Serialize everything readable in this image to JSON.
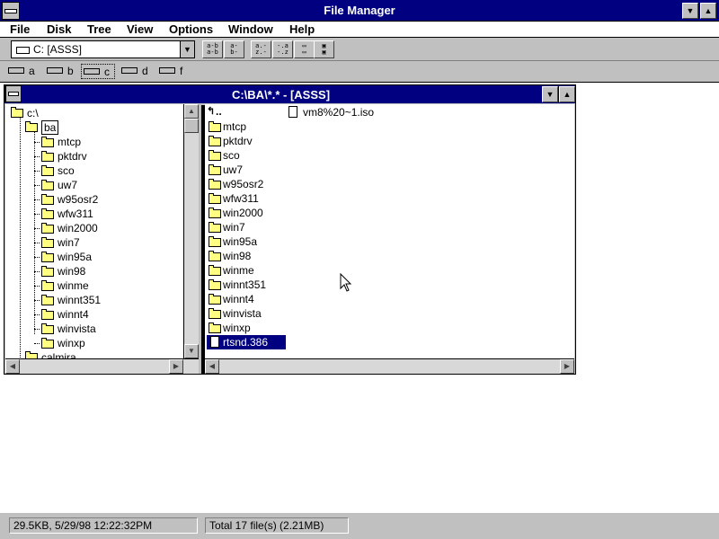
{
  "window": {
    "title": "File Manager"
  },
  "menu": [
    "File",
    "Disk",
    "Tree",
    "View",
    "Options",
    "Window",
    "Help"
  ],
  "toolbar": {
    "drive_combo": "C: [ASSS]"
  },
  "drives": [
    {
      "letter": "a",
      "selected": false
    },
    {
      "letter": "b",
      "selected": false
    },
    {
      "letter": "c",
      "selected": true
    },
    {
      "letter": "d",
      "selected": false
    },
    {
      "letter": "f",
      "selected": false
    }
  ],
  "child": {
    "title": "C:\\BA\\*.* - [ASSS]"
  },
  "tree": {
    "root": "c:\\",
    "current": "ba",
    "subfolders": [
      "mtcp",
      "pktdrv",
      "sco",
      "uw7",
      "w95osr2",
      "wfw311",
      "win2000",
      "win7",
      "win95a",
      "win98",
      "winme",
      "winnt351",
      "winnt4",
      "winvista",
      "winxp"
    ],
    "next_sibling": "calmira"
  },
  "files": {
    "up_dir": "..",
    "first_file": "vm8%20~1.iso",
    "folders": [
      "mtcp",
      "pktdrv",
      "sco",
      "uw7",
      "w95osr2",
      "wfw311",
      "win2000",
      "win7",
      "win95a",
      "win98",
      "winme",
      "winnt351",
      "winnt4",
      "winvista",
      "winxp"
    ],
    "selected_file": "rtsnd.386"
  },
  "status": {
    "left": "29.5KB, 5/29/98 12:22:32PM",
    "right": "Total 17 file(s) (2.21MB)"
  },
  "colors": {
    "titlebar": "#000080",
    "folder": "#ffff80",
    "window_bg": "#c0c0c0"
  }
}
